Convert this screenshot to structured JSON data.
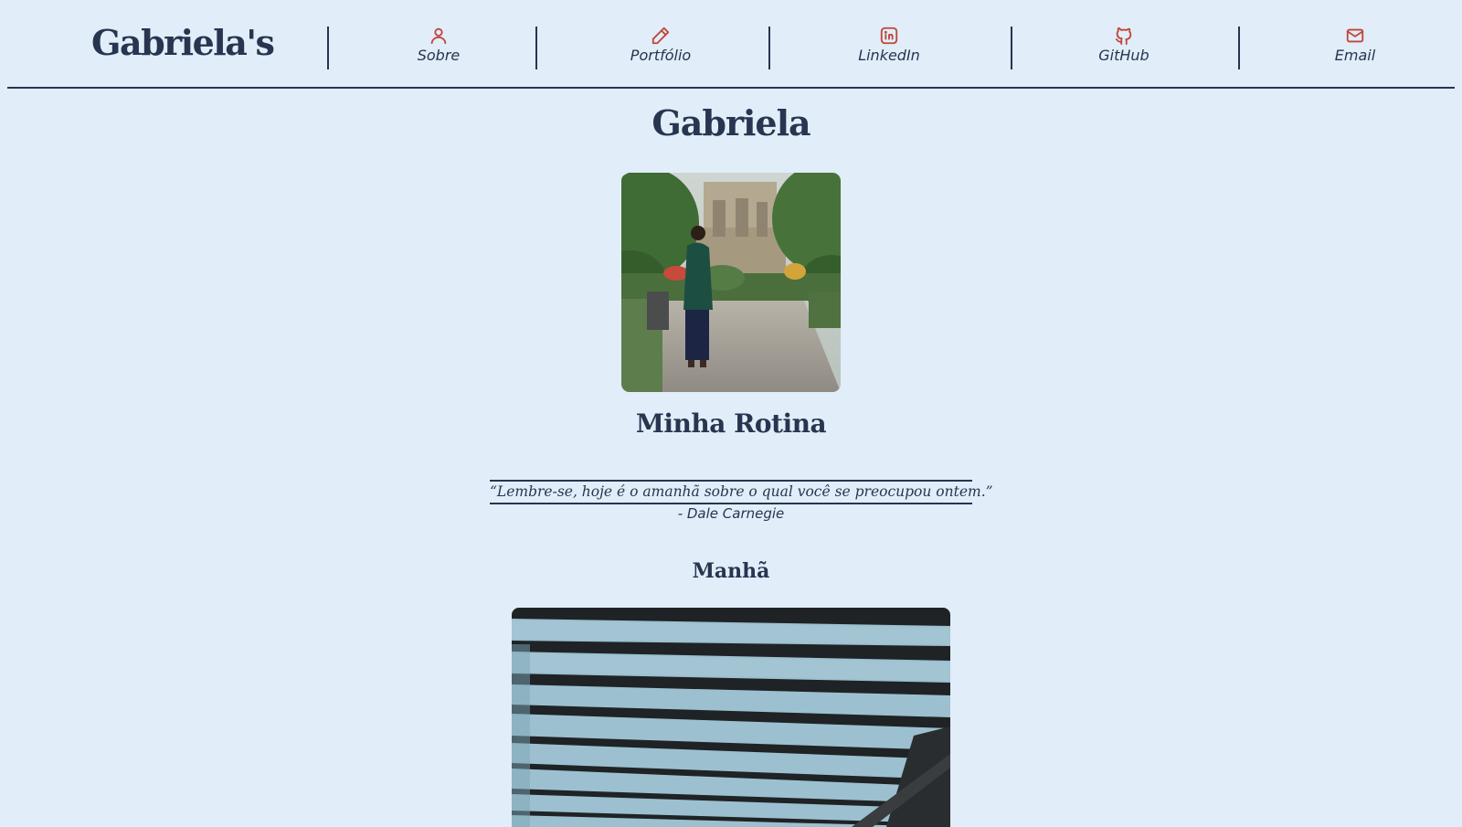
{
  "header": {
    "logo": "Gabriela's",
    "nav": [
      {
        "label": "Sobre",
        "icon": "user-icon"
      },
      {
        "label": "Portfólio",
        "icon": "pencil-icon"
      },
      {
        "label": "LinkedIn",
        "icon": "linkedin-icon"
      },
      {
        "label": "GitHub",
        "icon": "github-icon"
      },
      {
        "label": "Email",
        "icon": "mail-icon"
      }
    ]
  },
  "main": {
    "title": "Gabriela",
    "section_title": "Minha Rotina",
    "quote": "“Lembre-se, hoje é o amanhã sobre o qual você se preocupou ontem.”",
    "quote_author": "- Dale Carnegie",
    "morning_title": "Manhã"
  },
  "colors": {
    "background": "#e1edf8",
    "text": "#273550",
    "icon_accent": "#c0463a"
  }
}
